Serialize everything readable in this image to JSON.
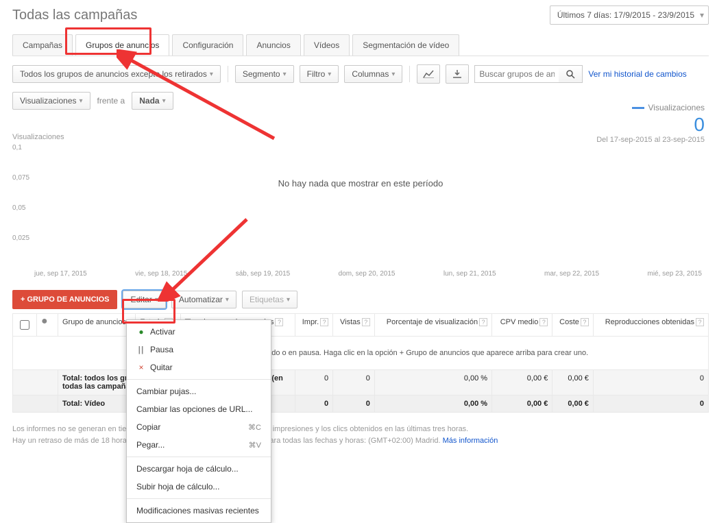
{
  "header": {
    "title": "Todas las campañas",
    "date_range": "Últimos 7 días: 17/9/2015 - 23/9/2015"
  },
  "tabs": {
    "items": [
      "Campañas",
      "Grupos de anuncios",
      "Configuración",
      "Anuncios",
      "Vídeos",
      "Segmentación de vídeo"
    ],
    "active": 1
  },
  "filter_bar": {
    "group_filter": "Todos los grupos de anuncios excepto los retirados",
    "segment": "Segmento",
    "filter": "Filtro",
    "columns": "Columnas",
    "search_placeholder": "Buscar grupos de anuncios",
    "history_link": "Ver mi historial de cambios"
  },
  "compare": {
    "metric": "Visualizaciones",
    "vs": "frente a",
    "none": "Nada"
  },
  "legend": {
    "metric": "Visualizaciones",
    "value": "0",
    "range": "Del 17-sep-2015 al 23-sep-2015"
  },
  "chart": {
    "ylabel": "Visualizaciones",
    "empty": "No hay nada que mostrar en este período",
    "y_ticks": [
      "0,1",
      "0,075",
      "0,05",
      "0,025"
    ],
    "x_ticks": [
      "jue, sep 17, 2015",
      "vie, sep 18, 2015",
      "sáb, sep 19, 2015",
      "dom, sep 20, 2015",
      "lun, sep 21, 2015",
      "mar, sep 22, 2015",
      "mié, sep 23, 2015"
    ]
  },
  "chart_data": {
    "type": "line",
    "title": "Visualizaciones",
    "ylabel": "Visualizaciones",
    "xlabel": "",
    "ylim": [
      0,
      0.1
    ],
    "categories": [
      "jue, sep 17, 2015",
      "vie, sep 18, 2015",
      "sáb, sep 19, 2015",
      "dom, sep 20, 2015",
      "lun, sep 21, 2015",
      "mar, sep 22, 2015",
      "mié, sep 23, 2015"
    ],
    "series": [
      {
        "name": "Visualizaciones",
        "values": [
          null,
          null,
          null,
          null,
          null,
          null,
          null
        ]
      }
    ],
    "empty_message": "No hay nada que mostrar en este período"
  },
  "actions": {
    "add": "GRUPO DE ANUNCIOS",
    "edit": "Editar",
    "automate": "Automatizar",
    "labels": "Etiquetas"
  },
  "edit_menu": {
    "activate": "Activar",
    "pause": "Pausa",
    "remove": "Quitar",
    "change_bids": "Cambiar pujas...",
    "change_url": "Cambiar las opciones de URL...",
    "copy": "Copiar",
    "copy_k": "⌘C",
    "paste": "Pegar...",
    "paste_k": "⌘V",
    "download": "Descargar hoja de cálculo...",
    "upload": "Subir hoja de cálculo...",
    "bulk": "Modificaciones masivas recientes"
  },
  "table": {
    "headers": {
      "group": "Grupo de anuncios",
      "status": "Estado",
      "type": "Tipo de grupo de anuncios",
      "impr": "Impr.",
      "views": "Vistas",
      "view_rate": "Porcentaje de visualización",
      "cpv": "CPV medio",
      "cost": "Coste",
      "plays": "Reproducciones obtenidas"
    },
    "empty_row": "No hay ningún grupo de anuncios habilitado o en pausa. Haga clic en la opción + Grupo de anuncios que aparece arriba para crear uno.",
    "total1_label": "Total: todos los grupos de anuncios excepto los retirados (en todas las campañas retiradas)",
    "total2_label": "Total: Vídeo",
    "totals": {
      "impr": "0",
      "views": "0",
      "view_rate": "0,00 %",
      "cpv": "0,00 €",
      "cost": "0,00 €",
      "plays": "0"
    }
  },
  "footer": {
    "l1a": "Los informes no se generan en tiempo real; es posible que no se incluyan las impresiones y los clics obtenidos en las últimas tres horas.",
    "l2a": "Hay un retraso de más de 18 horas para algunos parámetros. Zona horaria para todas las fechas y horas: (GMT+02:00) Madrid. ",
    "more": "Más información"
  }
}
